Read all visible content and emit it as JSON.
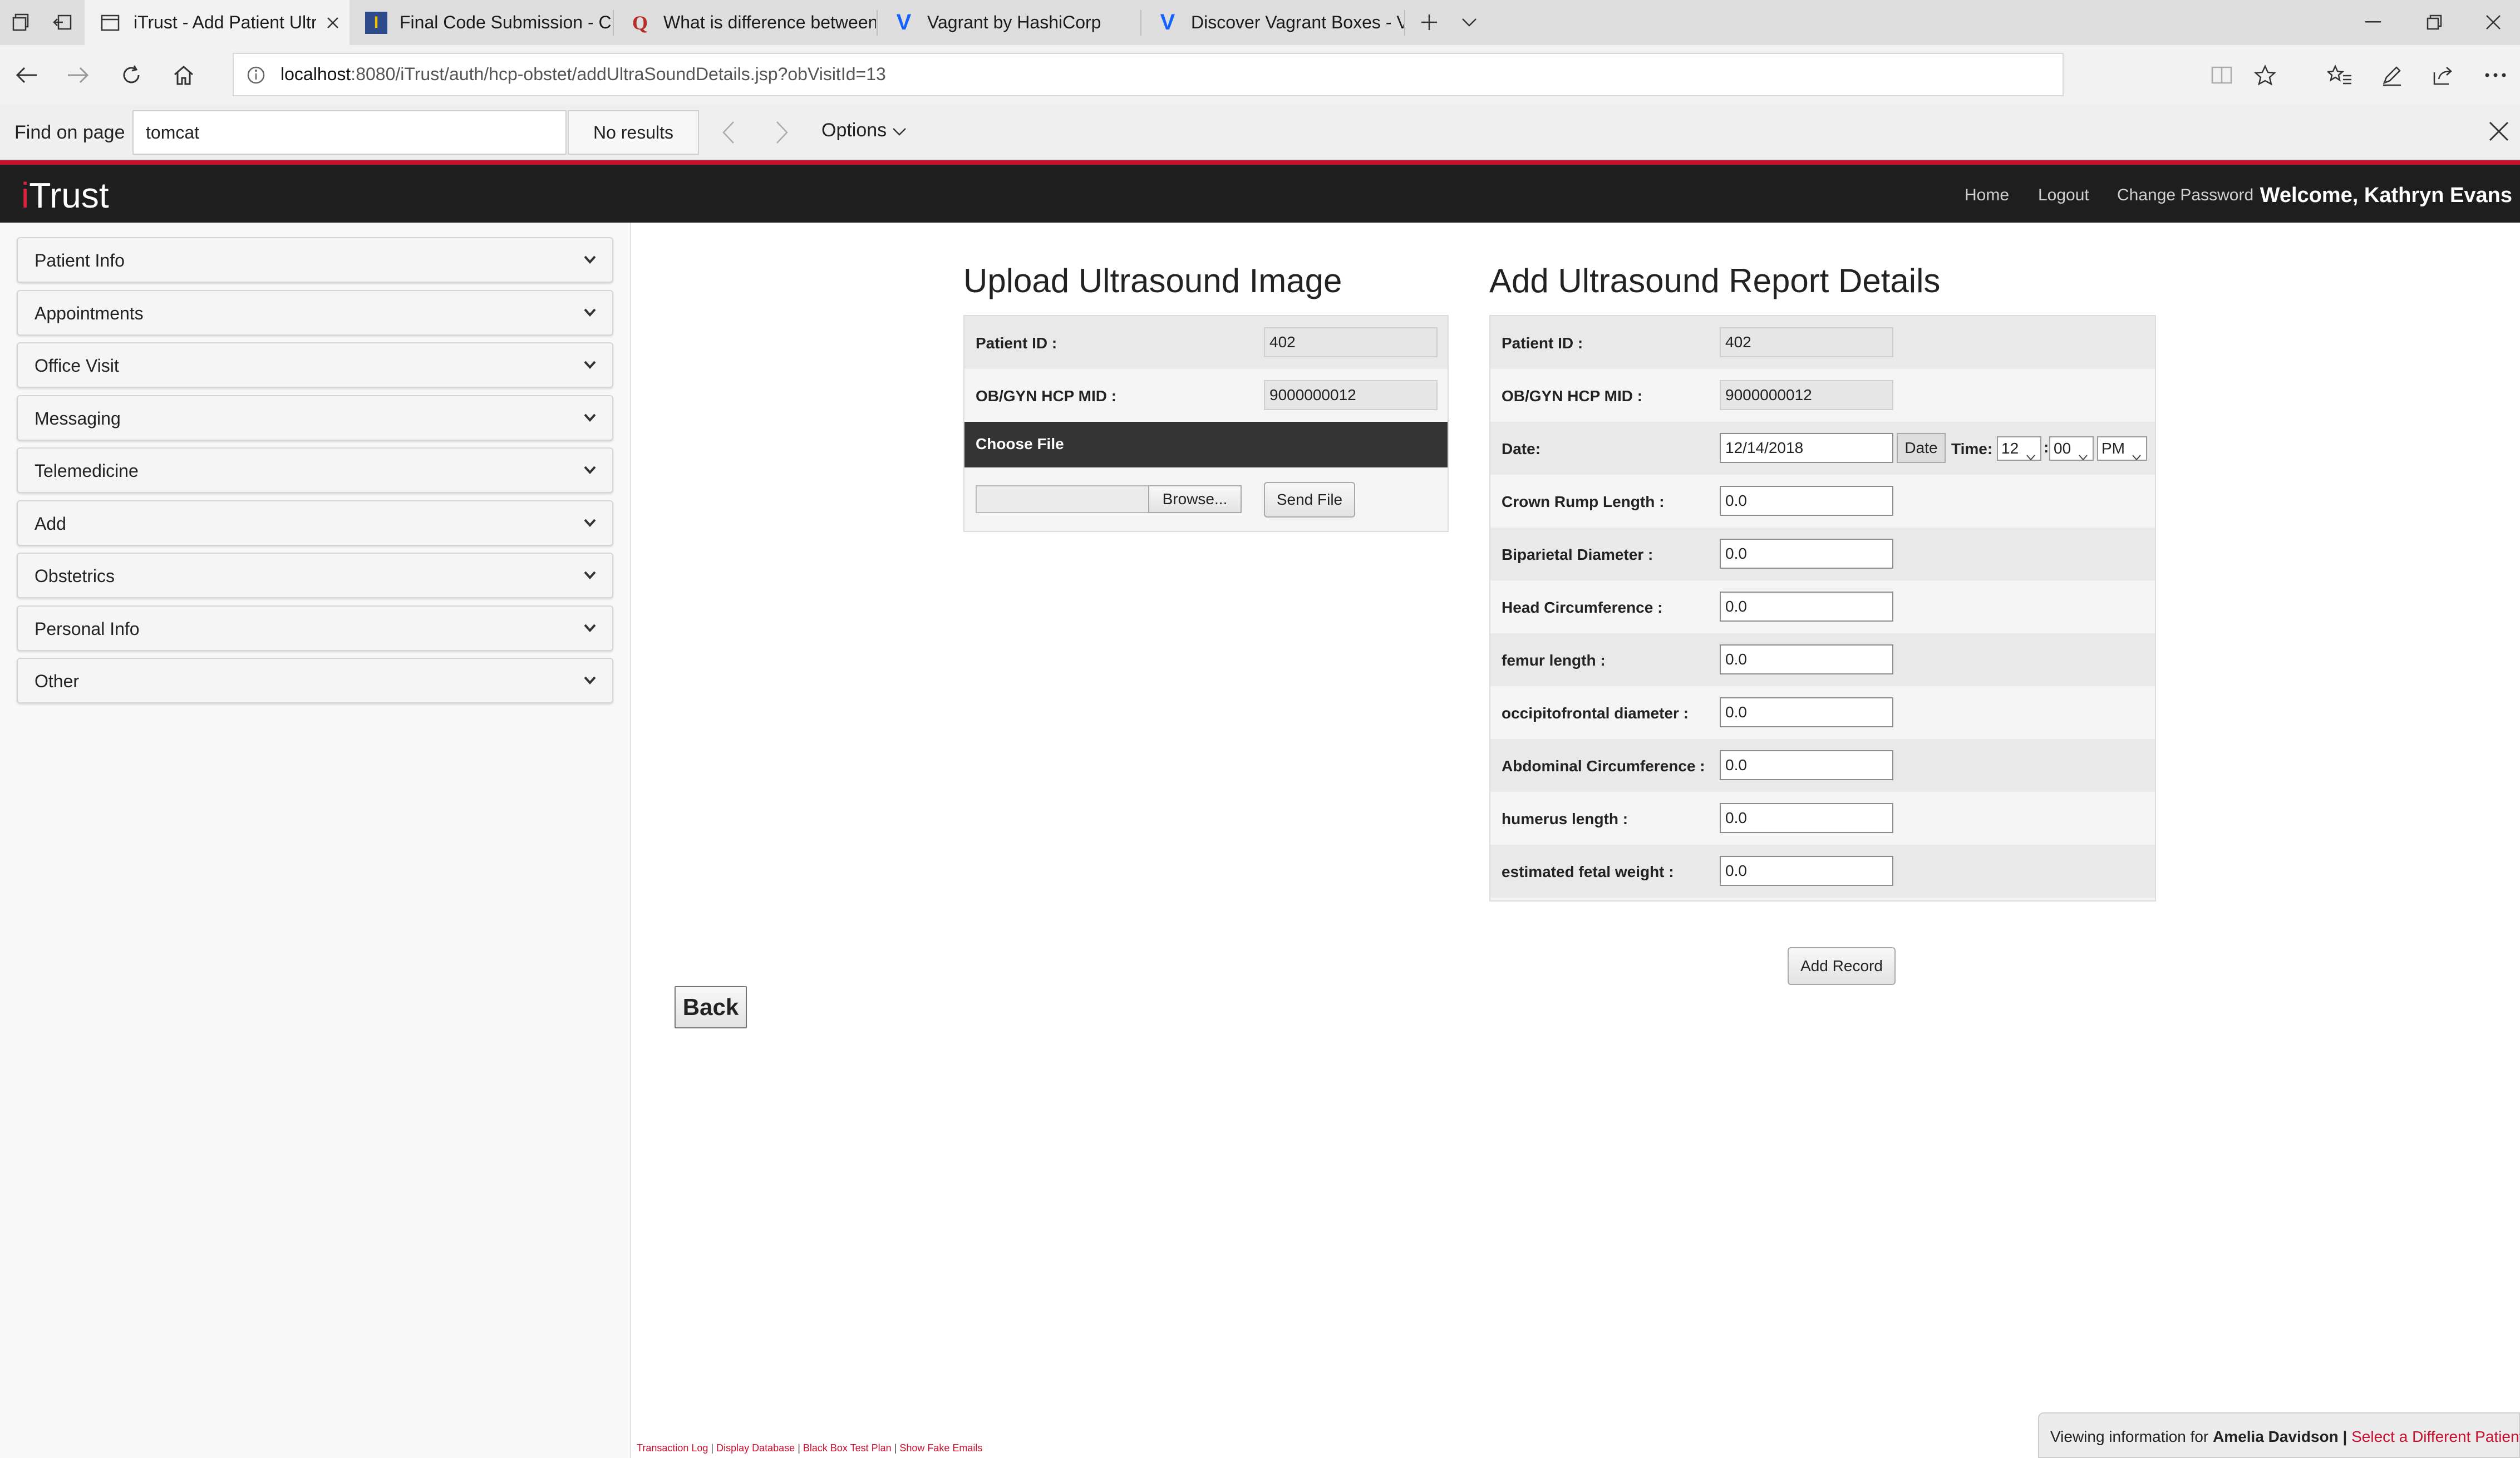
{
  "browser": {
    "tabs": [
      {
        "label": "iTrust - Add Patient Ultr",
        "icon": "page-icon",
        "active": true
      },
      {
        "label": "Final Code Submission - CS",
        "icon": "itrust-favicon-icon",
        "active": false
      },
      {
        "label": "What is difference between",
        "icon": "quora-icon",
        "active": false
      },
      {
        "label": "Vagrant by HashiCorp",
        "icon": "vagrant-icon",
        "active": false
      },
      {
        "label": "Discover Vagrant Boxes - Va",
        "icon": "vagrant-icon",
        "active": false
      }
    ],
    "url_host": "localhost",
    "url_rest": ":8080/iTrust/auth/hcp-obstet/addUltraSoundDetails.jsp?obVisitId=13",
    "find": {
      "label": "Find on page",
      "query": "tomcat",
      "results": "No results",
      "options_label": "Options"
    }
  },
  "header": {
    "logo_i": "i",
    "logo_rest": "Trust",
    "links": [
      "Home",
      "Logout",
      "Change Password"
    ],
    "welcome": "Welcome, Kathryn Evans"
  },
  "sidebar": {
    "items": [
      {
        "label": "Patient Info"
      },
      {
        "label": "Appointments"
      },
      {
        "label": "Office Visit"
      },
      {
        "label": "Messaging"
      },
      {
        "label": "Telemedicine"
      },
      {
        "label": "Add"
      },
      {
        "label": "Obstetrics"
      },
      {
        "label": "Personal Info"
      },
      {
        "label": "Other"
      }
    ]
  },
  "upload": {
    "title": "Upload Ultrasound Image",
    "patient_id_label": "Patient ID :",
    "patient_id": "402",
    "hcp_label": "OB/GYN HCP MID :",
    "hcp_mid": "9000000012",
    "choose_file_label": "Choose File",
    "browse_label": "Browse...",
    "send_label": "Send File"
  },
  "report": {
    "title": "Add Ultrasound Report Details",
    "patient_id_label": "Patient ID :",
    "patient_id": "402",
    "hcp_label": "OB/GYN HCP MID :",
    "hcp_mid": "9000000012",
    "date_label": "Date:",
    "date_value": "12/14/2018",
    "date_button": "Date",
    "time_label": "Time:",
    "time_hour": "12",
    "time_sep": ":",
    "time_minute": "00",
    "time_ampm": "PM",
    "fields": [
      {
        "label": "Crown Rump Length :",
        "value": "0.0"
      },
      {
        "label": "Biparietal Diameter :",
        "value": "0.0"
      },
      {
        "label": "Head Circumference :",
        "value": "0.0"
      },
      {
        "label": "femur length :",
        "value": "0.0"
      },
      {
        "label": "occipitofrontal diameter :",
        "value": "0.0"
      },
      {
        "label": "Abdominal Circumference :",
        "value": "0.0"
      },
      {
        "label": "humerus length :",
        "value": "0.0"
      },
      {
        "label": "estimated fetal weight :",
        "value": "0.0"
      }
    ],
    "add_record_label": "Add Record"
  },
  "back_label": "Back",
  "footer": {
    "links": [
      "Transaction Log",
      "Display Database",
      "Black Box Test Plan",
      "Show Fake Emails"
    ],
    "sep": " | ",
    "viewing_prefix": "Viewing information for ",
    "viewing_patient": "Amelia Davidson",
    "viewing_sep": " | ",
    "select_different": "Select a Different Patient"
  },
  "colors": {
    "brand_red": "#c8102e",
    "header_bg": "#1e1e1e",
    "choose_file_bar": "#333333"
  }
}
